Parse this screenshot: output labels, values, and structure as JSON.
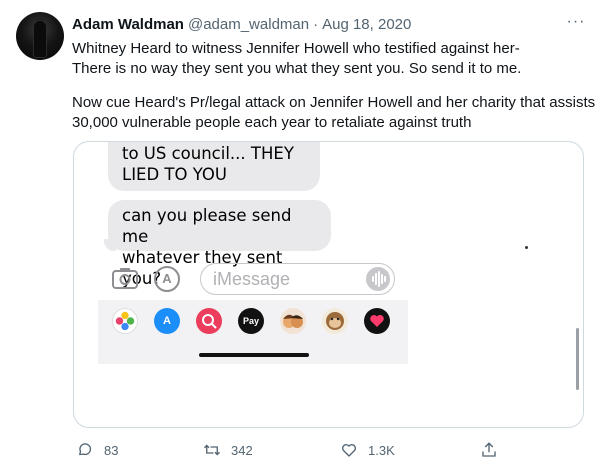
{
  "tweet": {
    "author_name": "Adam Waldman",
    "author_handle": "@adam_waldman",
    "separator": "·",
    "date": "Aug 18, 2020",
    "more_label": "···",
    "lines": [
      "Whitney Heard to witness Jennifer Howell who testified against her-",
      "There is no way they sent you what they sent you. So send it to me.",
      "Now cue Heard's Pr/legal attack on Jennifer Howell and her charity that assists",
      "30,000 vulnerable people each year to retaliate against truth"
    ]
  },
  "screenshot": {
    "bubble1": [
      "to US council... THEY",
      "LIED TO YOU"
    ],
    "bubble2": [
      "can you please send me",
      "whatever they sent you?"
    ],
    "input_placeholder": "iMessage",
    "apps": [
      {
        "name": "photos-app-icon",
        "color": "#ffffff",
        "label": ""
      },
      {
        "name": "app-store-icon",
        "color": "#1c8ef9",
        "label": "A"
      },
      {
        "name": "images-search-icon",
        "color": "#ec3d5c",
        "label": ""
      },
      {
        "name": "apple-pay-icon",
        "color": "#111111",
        "label": "Pay"
      },
      {
        "name": "memoji-icon",
        "color": "#f4f4f4",
        "label": ""
      },
      {
        "name": "animoji-monkey-icon",
        "color": "#f4f4f4",
        "label": ""
      },
      {
        "name": "digital-touch-icon",
        "color": "#111111",
        "label": ""
      }
    ]
  },
  "actions": {
    "replies": "83",
    "retweets": "342",
    "likes": "1.3K"
  },
  "colors": {
    "text": "#0f1419",
    "secondary": "#536471",
    "border": "#cfd9de",
    "bubble": "#e9e9eb"
  }
}
